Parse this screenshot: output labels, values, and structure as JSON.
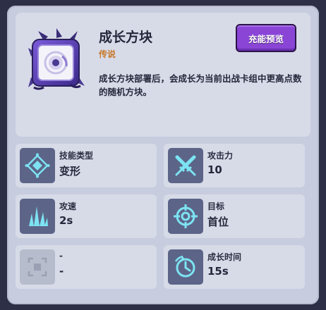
{
  "card": {
    "name": "成长方块",
    "rarity": "传说",
    "description": "成长方块部署后，会成长为当前出战卡组中更高点数的随机方块。",
    "portrait_icon": "purple-dragon-dice",
    "rarity_color": "#c7792b"
  },
  "preview_button": {
    "label": "充能预览",
    "color": "#8a45d6"
  },
  "stats": [
    {
      "label": "技能类型",
      "value": "变形",
      "icon": "transform-diamond-icon"
    },
    {
      "label": "攻击力",
      "value": "10",
      "icon": "crossed-swords-icon"
    },
    {
      "label": "攻速",
      "value": "2s",
      "icon": "attack-speed-spikes-icon"
    },
    {
      "label": "目标",
      "value": "首位",
      "icon": "crosshair-target-icon"
    },
    {
      "label": "-",
      "value": "-",
      "icon": "empty-slot-icon"
    },
    {
      "label": "成长时间",
      "value": "15s",
      "icon": "clock-growth-icon"
    }
  ]
}
